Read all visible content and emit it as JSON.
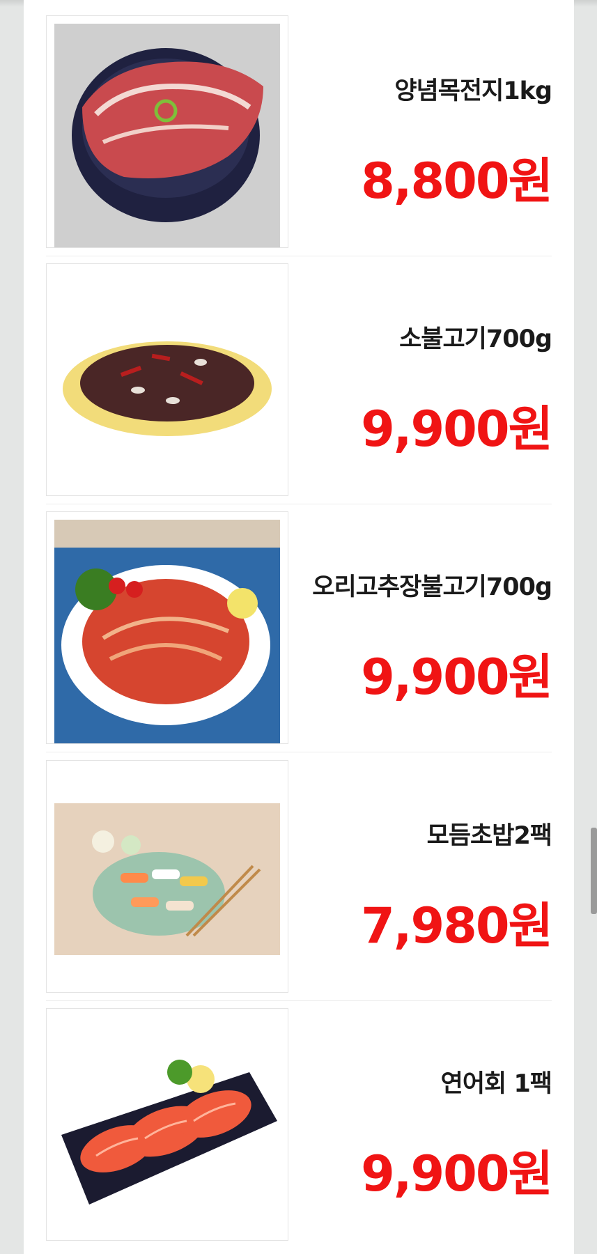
{
  "products": [
    {
      "name": "양념목전지1kg",
      "price": "8,800원",
      "image": "marinated-pork-shoulder"
    },
    {
      "name": "소불고기700g",
      "price": "9,900원",
      "image": "beef-bulgogi"
    },
    {
      "name": "오리고추장불고기700g",
      "price": "9,900원",
      "image": "duck-gochujang-bulgogi"
    },
    {
      "name": "모듬초밥2팩",
      "price": "7,980원",
      "image": "assorted-sushi"
    },
    {
      "name": "연어회 1팩",
      "price": "9,900원",
      "image": "salmon-sashimi"
    }
  ],
  "colors": {
    "price": "#f01414",
    "name": "#1a1a1a",
    "background": "#e4e6e5"
  }
}
